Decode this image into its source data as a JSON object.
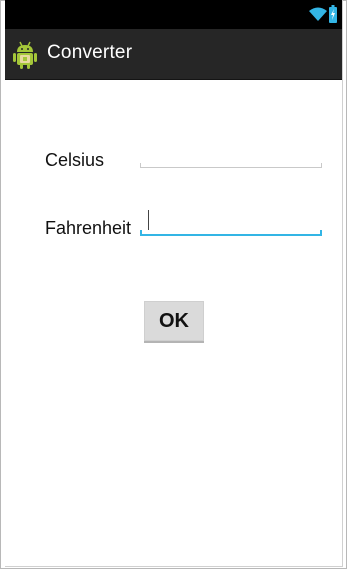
{
  "status_bar": {
    "icons": [
      "wifi-icon",
      "battery-charging-icon"
    ],
    "accent": "#33b5e5"
  },
  "action_bar": {
    "title": "Converter",
    "icon": "android-app-icon"
  },
  "form": {
    "celsius_label": "Celsius",
    "celsius_value": "",
    "fahrenheit_label": "Fahrenheit",
    "fahrenheit_value": "",
    "ok_label": "OK"
  },
  "colors": {
    "status_bar_bg": "#000000",
    "action_bar_bg": "#262626",
    "focus_accent": "#33b5e5",
    "button_bg": "#dadada"
  }
}
